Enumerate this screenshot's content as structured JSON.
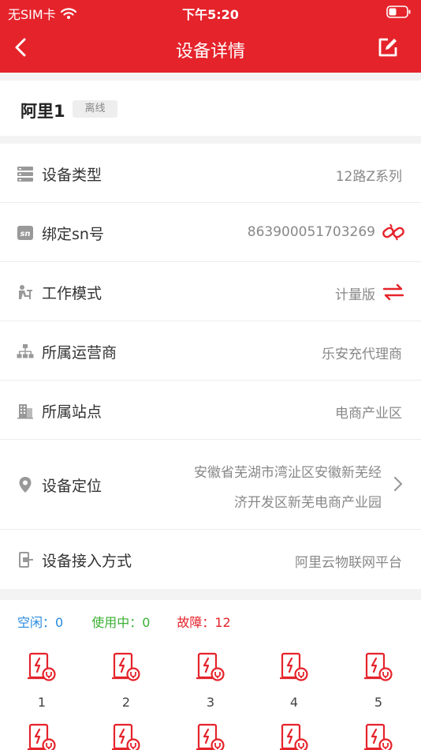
{
  "status_bar": {
    "carrier": "无SIM卡",
    "time": "下午5:20"
  },
  "nav": {
    "title": "设备详情"
  },
  "device": {
    "name": "阿里1",
    "status": "离线"
  },
  "info": {
    "type": {
      "label": "设备类型",
      "value": "12路Z系列",
      "icon": "server-icon"
    },
    "sn": {
      "label": "绑定sn号",
      "value": "863900051703269",
      "icon": "sn-icon",
      "action_icon": "unbind-link-icon"
    },
    "mode": {
      "label": "工作模式",
      "value": "计量版",
      "icon": "worker-icon",
      "action_icon": "switch-arrows-icon"
    },
    "operator": {
      "label": "所属运营商",
      "value": "乐安充代理商",
      "icon": "org-tree-icon"
    },
    "station": {
      "label": "所属站点",
      "value": "电商产业区",
      "icon": "building-icon"
    },
    "location": {
      "label": "设备定位",
      "value_line1": "安徽省芜湖市湾沚区安徽新芜经",
      "value_line2": "济开发区新芜电商产业园",
      "icon": "location-pin-icon"
    },
    "access": {
      "label": "设备接入方式",
      "value": "阿里云物联网平台",
      "icon": "access-icon"
    }
  },
  "ports": {
    "idle_label": "空闲：0",
    "in_use_label": "使用中：0",
    "fault_label": "故障：12",
    "items": [
      {
        "number": "1"
      },
      {
        "number": "2"
      },
      {
        "number": "3"
      },
      {
        "number": "4"
      },
      {
        "number": "5"
      },
      {
        "number": ""
      },
      {
        "number": ""
      },
      {
        "number": ""
      },
      {
        "number": ""
      },
      {
        "number": ""
      }
    ]
  },
  "colors": {
    "brand": "#e5232b",
    "idle": "#2a8ae0",
    "in_use": "#3cb034",
    "fault": "#e5232b"
  }
}
